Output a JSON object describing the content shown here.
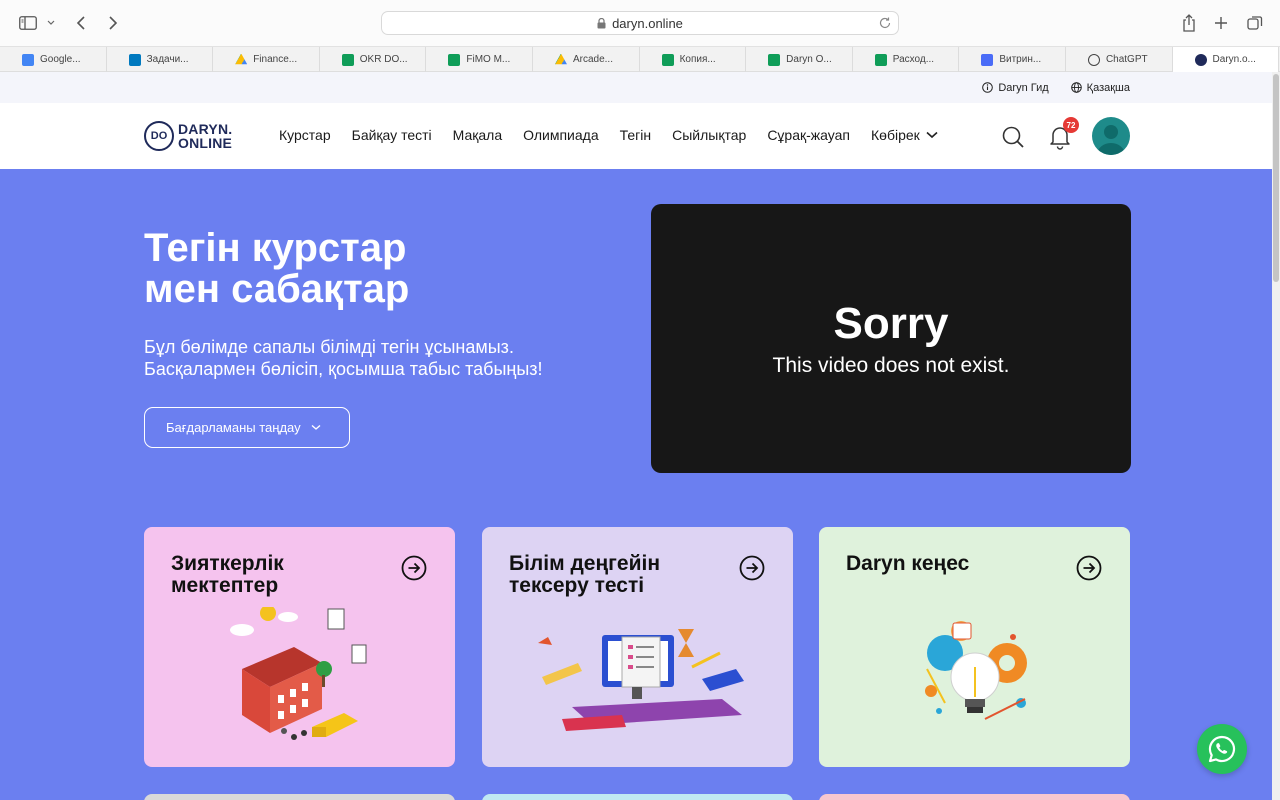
{
  "browser": {
    "url": "daryn.online",
    "tabs": [
      {
        "label": "Google...",
        "icon": "calendar-icon",
        "color": "#4285f4"
      },
      {
        "label": "Задачи...",
        "icon": "trello-icon",
        "color": "#0079bf"
      },
      {
        "label": "Finance...",
        "icon": "drive-icon",
        "color": "#34a853"
      },
      {
        "label": "OKR DO...",
        "icon": "sheets-icon",
        "color": "#0f9d58"
      },
      {
        "label": "FiMO M...",
        "icon": "sheets-icon",
        "color": "#0f9d58"
      },
      {
        "label": "Arcade...",
        "icon": "drive-icon",
        "color": "#fbbc04"
      },
      {
        "label": "Копия...",
        "icon": "sheets-icon",
        "color": "#0f9d58"
      },
      {
        "label": "Daryn O...",
        "icon": "sheets-icon",
        "color": "#0f9d58"
      },
      {
        "label": "Расход...",
        "icon": "sheets-icon",
        "color": "#0f9d58"
      },
      {
        "label": "Витрин...",
        "icon": "gift-icon",
        "color": "#4a6cf7"
      },
      {
        "label": "ChatGPT",
        "icon": "chatgpt-icon",
        "color": "#444444"
      },
      {
        "label": "Daryn.o...",
        "icon": "daryn-icon",
        "color": "#1f2a5a"
      }
    ]
  },
  "topstrip": {
    "guide_label": "Daryn Гид",
    "language_label": "Қазақша"
  },
  "header": {
    "logo_mark": "DO",
    "logo_line1": "DARYN.",
    "logo_line2": "ONLINE",
    "nav": [
      {
        "label": "Курстар"
      },
      {
        "label": "Байқау тесті"
      },
      {
        "label": "Мақала"
      },
      {
        "label": "Олимпиада"
      },
      {
        "label": "Тегін"
      },
      {
        "label": "Сыйлықтар"
      },
      {
        "label": "Сұрақ-жауап"
      },
      {
        "label": "Көбірек"
      }
    ],
    "notifications_count": "72"
  },
  "hero": {
    "title_line1": "Тегін курстар",
    "title_line2": "мен сабақтар",
    "subtitle_line1": "Бұл бөлімде сапалы білімді тегін ұсынамыз.",
    "subtitle_line2": "Басқалармен бөлісіп, қосымша табыс табыңыз!",
    "program_select_label": "Бағдарламаны таңдау"
  },
  "video": {
    "title": "Sorry",
    "message": "This video does not exist."
  },
  "cards": [
    {
      "title_line1": "Зияткерлік",
      "title_line2": "мектептер",
      "bg": "#f5c3ee"
    },
    {
      "title_line1": "Білім деңгейін",
      "title_line2": "тексеру тесті",
      "bg": "#ddd3f3"
    },
    {
      "title_line1": "Daryn кеңес",
      "title_line2": "",
      "bg": "#dff2dc"
    }
  ],
  "colors": {
    "hero_bg": "#6b7ff0",
    "video_bg": "#171717",
    "whatsapp": "#27c15b",
    "badge": "#e53935"
  }
}
